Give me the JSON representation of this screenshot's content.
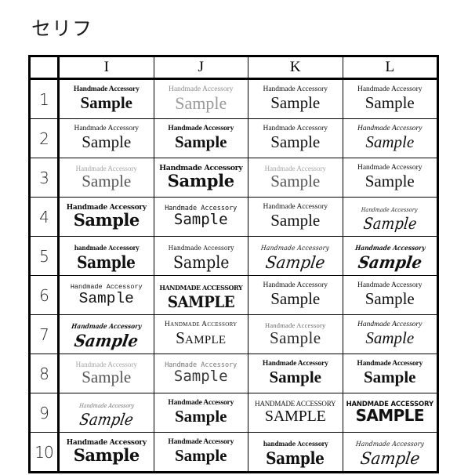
{
  "title": "セリフ",
  "table": {
    "corner_label": "",
    "columns": [
      "I",
      "J",
      "K",
      "L"
    ],
    "rows": [
      {
        "number": "1",
        "cells": [
          {
            "top": "Handmade Accessory",
            "main": "Sample",
            "style": "f-serif-bold"
          },
          {
            "top": "Handmade Accessory",
            "main": "Sample",
            "style": "f-serif-light"
          },
          {
            "top": "Handmade Accessory",
            "main": "Sample",
            "style": "f-serif"
          },
          {
            "top": "Handmade Accessory",
            "main": "Sample",
            "style": "f-serif"
          }
        ]
      },
      {
        "number": "2",
        "cells": [
          {
            "top": "Handmade Accessory",
            "main": "Sample",
            "style": "f-serif"
          },
          {
            "top": "Handmade Accessory",
            "main": "Sample",
            "style": "f-serif-bold"
          },
          {
            "top": "Handmade Accessory",
            "main": "Sample",
            "style": "f-serif"
          },
          {
            "top": "Handmade Accessory",
            "main": "Sample",
            "style": "f-serif-italic"
          }
        ]
      },
      {
        "number": "3",
        "cells": [
          {
            "top": "Handmade Accessory",
            "main": "Sample",
            "style": "f-serif-thin"
          },
          {
            "top": "Handmade Accessory",
            "main": "Sample",
            "style": "f-serif-black"
          },
          {
            "top": "Handmade Accessory",
            "main": "Sample",
            "style": "f-serif-thin"
          },
          {
            "top": "Handmade Accessory",
            "main": "Sample",
            "style": "f-serif"
          }
        ]
      },
      {
        "number": "4",
        "cells": [
          {
            "top": "Handmade Accessory",
            "main": "Sample",
            "style": "f-slab"
          },
          {
            "top": "Handmade Accessory",
            "main": "Sample",
            "style": "f-mono"
          },
          {
            "top": "Handmade Accessory",
            "main": "Sample",
            "style": "f-serif"
          },
          {
            "top": "Handmade Accessory",
            "main": "Sample",
            "style": "f-fancy"
          }
        ]
      },
      {
        "number": "5",
        "cells": [
          {
            "top": "handmade Accessory",
            "main": "Sample",
            "style": "f-gothic"
          },
          {
            "top": "Handmade Accessory",
            "main": "Sample",
            "style": "f-gothic-light"
          },
          {
            "top": "Handmade Accessory",
            "main": "Sample",
            "style": "f-script"
          },
          {
            "top": "Handmade Accessory",
            "main": "Sample",
            "style": "f-script-bold"
          }
        ]
      },
      {
        "number": "6",
        "cells": [
          {
            "top": "Handmade Accessory",
            "main": "Sample",
            "style": "f-mono-bold"
          },
          {
            "top": "HANDMADE ACCESSORY",
            "main": "SAMPLE",
            "style": "f-caps-bold"
          },
          {
            "top": "Handmade Accessory",
            "main": "Sample",
            "style": "f-serif"
          },
          {
            "top": "Handmade Accessory",
            "main": "Sample",
            "style": "f-serif"
          }
        ]
      },
      {
        "number": "7",
        "cells": [
          {
            "top": "Handmade Accessory",
            "main": "Sample",
            "style": "f-script-bold"
          },
          {
            "top": "Handmade Accessory",
            "main": "Sample",
            "style": "f-smallcaps"
          },
          {
            "top": "Handmade Accessory",
            "main": "Sample",
            "style": "f-deco"
          },
          {
            "top": "Handmade Accessory",
            "main": "Sample",
            "style": "f-serif-italic"
          }
        ]
      },
      {
        "number": "8",
        "cells": [
          {
            "top": "Handmade Accessory",
            "main": "Sample",
            "style": "f-serif-thin"
          },
          {
            "top": "Handmade Accessory",
            "main": "Sample",
            "style": "f-mono-light"
          },
          {
            "top": "Handmade Accessory",
            "main": "Sample",
            "style": "f-serif-bold"
          },
          {
            "top": "Handmade Accessory",
            "main": "Sample",
            "style": "f-serif-bold"
          }
        ]
      },
      {
        "number": "9",
        "cells": [
          {
            "top": "Handmade Accessory",
            "main": "Sample",
            "style": "f-script-fine"
          },
          {
            "top": "Handmade Accessory",
            "main": "Sample",
            "style": "f-serif-bold"
          },
          {
            "top": "HANDMADE ACCESSORY",
            "main": "SAMPLE",
            "style": "f-caps"
          },
          {
            "top": "HANDMADE ACCESSORY",
            "main": "SAMPLE",
            "style": "f-caps-sans"
          }
        ]
      },
      {
        "number": "10",
        "cells": [
          {
            "top": "Handmade Accessory",
            "main": "Sample",
            "style": "f-slab"
          },
          {
            "top": "Handmade Accessory",
            "main": "Sample",
            "style": "f-serif-bold"
          },
          {
            "top": "handmade Accessory",
            "main": "Sample",
            "style": "f-gothic"
          },
          {
            "top": "Handmade Accessory",
            "main": "Sample",
            "style": "f-script"
          }
        ]
      }
    ]
  }
}
